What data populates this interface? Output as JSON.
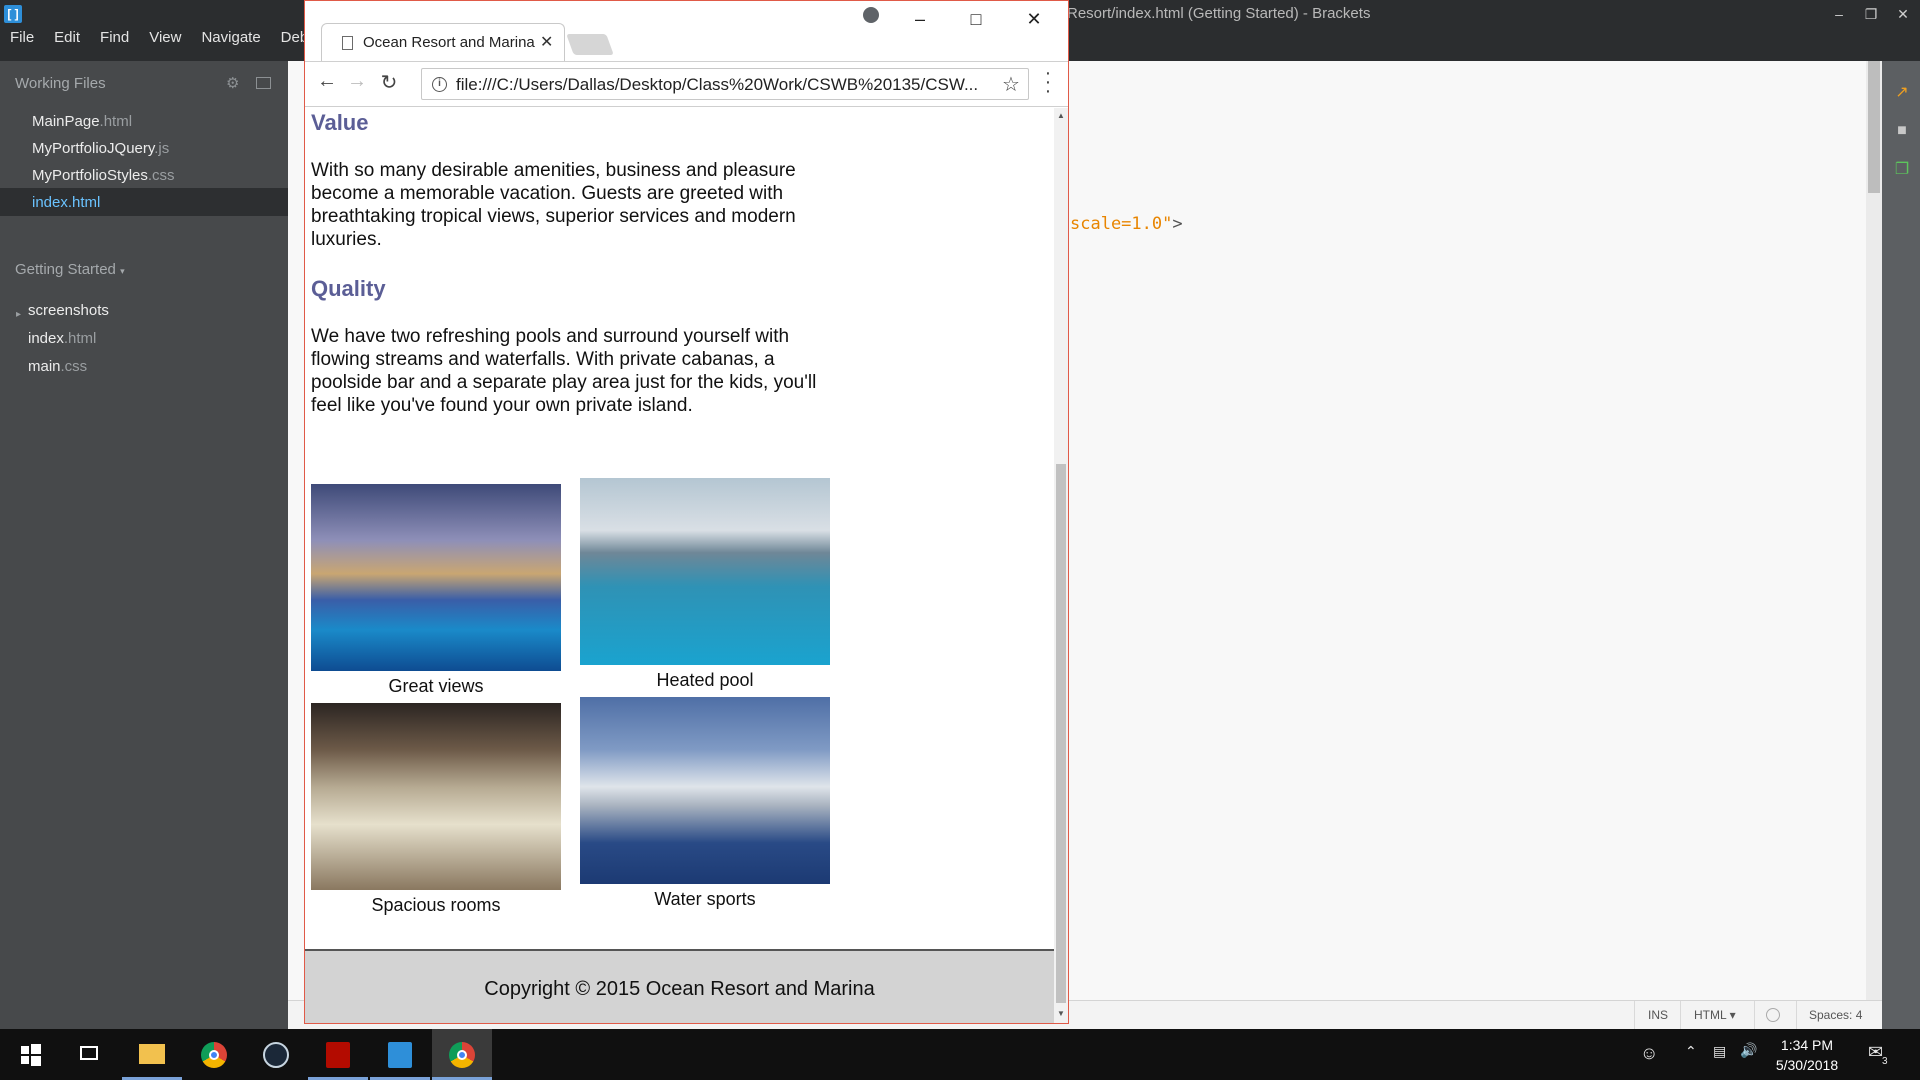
{
  "brackets": {
    "title": "Resort/index.html (Getting Started) - Brackets",
    "menu": [
      "File",
      "Edit",
      "Find",
      "View",
      "Navigate",
      "Debug"
    ],
    "working_files_label": "Working Files",
    "working_files": [
      {
        "name": "MainPage",
        "ext": ".html"
      },
      {
        "name": "MyPortfolioJQuery",
        "ext": ".js"
      },
      {
        "name": "MyPortfolioStyles",
        "ext": ".css"
      },
      {
        "name": "index",
        "ext": ".html"
      }
    ],
    "project_label": "Getting Started",
    "project_tree": [
      {
        "name": "screenshots",
        "ext": ""
      },
      {
        "name": "index",
        "ext": ".html"
      },
      {
        "name": "main",
        "ext": ".css"
      }
    ],
    "code_fragment_value": "scale=1.0\"",
    "code_fragment_close": ">",
    "status": {
      "mode": "INS",
      "language": "HTML",
      "spaces": "Spaces: 4"
    }
  },
  "chrome": {
    "tab_title": "Ocean Resort and Marina",
    "url": "file:///C:/Users/Dallas/Desktop/Class%20Work/CSWB%20135/CSW..."
  },
  "page": {
    "sections": [
      {
        "heading": "Value",
        "text": "With so many desirable amenities, business and pleasure become a memorable vacation. Guests are greeted with breathtaking tropical views, superior services and modern luxuries."
      },
      {
        "heading": "Quality",
        "text": "We have two refreshing pools and surround yourself with flowing streams and waterfalls. With private cabanas, a poolside bar and a separate play area just for the kids, you'll feel like you've found your own private island."
      }
    ],
    "gallery": [
      {
        "caption": "Great views"
      },
      {
        "caption": "Heated pool"
      },
      {
        "caption": "Spacious rooms"
      },
      {
        "caption": "Water sports"
      }
    ],
    "footer": "Copyright © 2015 Ocean Resort and Marina"
  },
  "taskbar": {
    "time": "1:34 PM",
    "date": "5/30/2018",
    "notification_count": "3"
  }
}
